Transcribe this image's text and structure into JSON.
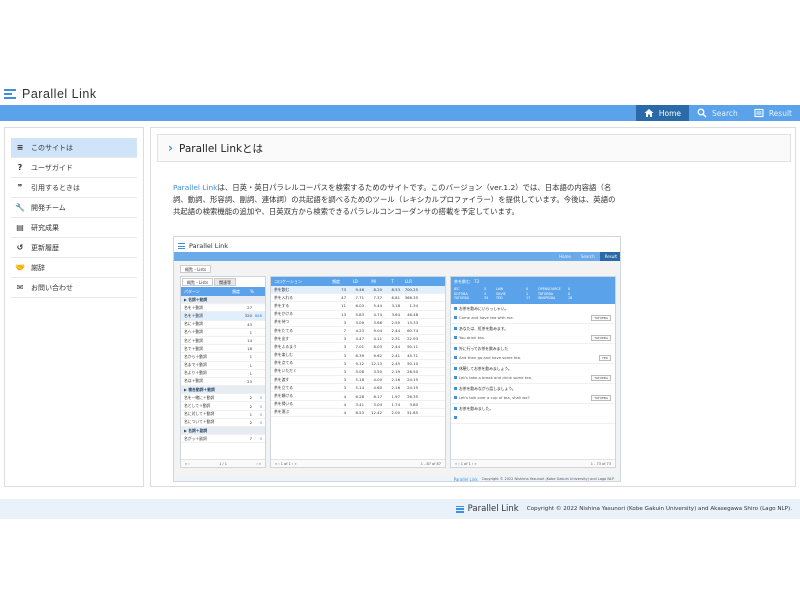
{
  "site": {
    "title": "Parallel Link"
  },
  "nav": {
    "items": [
      {
        "label": "Home",
        "icon": "home-icon"
      },
      {
        "label": "Search",
        "icon": "search-icon"
      },
      {
        "label": "Result",
        "icon": "result-icon"
      }
    ]
  },
  "sidebar": {
    "items": [
      {
        "label": "このサイトは",
        "icon": "list-icon",
        "glyph": "≡"
      },
      {
        "label": "ユーザガイド",
        "icon": "question-icon",
        "glyph": "?"
      },
      {
        "label": "引用するときは",
        "icon": "quote-icon",
        "glyph": "❞"
      },
      {
        "label": "開発チーム",
        "icon": "wrench-icon",
        "glyph": "🔧"
      },
      {
        "label": "研究成果",
        "icon": "document-icon",
        "glyph": "▤"
      },
      {
        "label": "更新履歴",
        "icon": "history-icon",
        "glyph": "↺"
      },
      {
        "label": "謝辞",
        "icon": "handshake-icon",
        "glyph": "🤝"
      },
      {
        "label": "お問い合わせ",
        "icon": "mail-icon",
        "glyph": "✉"
      }
    ]
  },
  "main": {
    "heading": "Parallel Linkとは",
    "intro_brand": "Parallel Link",
    "intro_text": "は、日英・英日パラレルコーパスを検索するためのサイトです。このバージョン（ver.1.2）では、日本語の内容語（名詞、動詞、形容詞、副詞、連体詞）の共起語を調べるためのツール（レキシカルプロファイラー）を提供しています。今後は、英語の共起語の検索機能の追加や、日英双方から検索できるパラレルコンコーダンサの搭載を予定しています。"
  },
  "preview": {
    "title": "Parallel Link",
    "nav": [
      "Home",
      "Search",
      "Result"
    ],
    "tabs": [
      "概覧・Lists",
      "関連等"
    ],
    "left_header": [
      "パターン",
      "頻度",
      "%"
    ],
    "left_rows": [
      {
        "t": "▶ 名詞＋動詞",
        "grp": true
      },
      {
        "t": "名を＋動詞",
        "n": "27",
        "p": ""
      },
      {
        "t": "名を＋動詞",
        "n": "320",
        "p": "888",
        "sel": true
      },
      {
        "t": "名に＋動詞",
        "n": "43",
        "p": ""
      },
      {
        "t": "名へ＋動詞",
        "n": "1",
        "p": ""
      },
      {
        "t": "名と＋動詞",
        "n": "14",
        "p": ""
      },
      {
        "t": "名で＋動詞",
        "n": "18",
        "p": ""
      },
      {
        "t": "名から＋動詞",
        "n": "1",
        "p": ""
      },
      {
        "t": "名まで＋動詞",
        "n": "1",
        "p": ""
      },
      {
        "t": "名より＋動詞",
        "n": "1",
        "p": ""
      },
      {
        "t": "名は＋動詞",
        "n": "23",
        "p": ""
      },
      {
        "t": "▶ 複合動詞＋動詞",
        "grp": true
      },
      {
        "t": "名を一緒に＋動詞",
        "n": "2",
        "p": "5"
      },
      {
        "t": "名として＋動詞",
        "n": "2",
        "p": "5"
      },
      {
        "t": "名に対して＋動詞",
        "n": "1",
        "p": "5"
      },
      {
        "t": "名について＋動詞",
        "n": "2",
        "p": "5"
      },
      {
        "t": "▶ 名詞＋副詞",
        "grp": true
      },
      {
        "t": "名がッ＋副詞",
        "n": "7",
        "p": "5"
      }
    ],
    "left_pager": "1 / 1",
    "mid_header": [
      "コロケーション",
      "頻度",
      "LD",
      "MI",
      "T",
      "LLR"
    ],
    "mid_rows": [
      [
        "茶を飲む",
        "73",
        "9.46",
        "8.20",
        "8.53",
        "700.25"
      ],
      [
        "茶を入れる",
        "47",
        "7.71",
        "7.37",
        "6.81",
        "366.35"
      ],
      [
        "茶をする",
        "11",
        "6.03",
        "5.44",
        "3.18",
        "1.34"
      ],
      [
        "茶をかける",
        "13",
        "5.83",
        "4.74",
        "3.64",
        "46.48"
      ],
      [
        "茶を持つ",
        "3",
        "3.09",
        "3.66",
        "2.55",
        "13.33"
      ],
      [
        "茶をたてる",
        "7",
        "4.23",
        "9.04",
        "2.44",
        "60.74"
      ],
      [
        "茶を出す",
        "3",
        "4.47",
        "4.11",
        "2.31",
        "22.93"
      ],
      [
        "茶をふるまう",
        "3",
        "7.01",
        "8.03",
        "2.44",
        "50.11"
      ],
      [
        "茶を楽しむ",
        "3",
        "6.39",
        "9.62",
        "2.41",
        "45.71"
      ],
      [
        "茶を点てる",
        "3",
        "9.12",
        "12.13",
        "2.45",
        "50.10"
      ],
      [
        "茶をいただく",
        "3",
        "5.08",
        "3.50",
        "2.19",
        "28.50"
      ],
      [
        "茶を渡す",
        "3",
        "5.18",
        "4.00",
        "2.16",
        "24.15"
      ],
      [
        "茶を立てる",
        "3",
        "5.14",
        "4.60",
        "2.16",
        "24.15"
      ],
      [
        "茶を頼ける",
        "4",
        "6.28",
        "6.17",
        "1.97",
        "26.35"
      ],
      [
        "茶を掃いる",
        "4",
        "3.41",
        "3.04",
        "1.74",
        "3.80"
      ],
      [
        "茶を運ぶ",
        "4",
        "6.53",
        "12.42",
        "2.00",
        "51.85"
      ]
    ],
    "mid_pager": "1 - 87 of 87",
    "right_header": "茶を飲む　73",
    "right_stats": [
      [
        "JEC",
        "5",
        "LAW",
        "0",
        "OPENSOURCE",
        "0"
      ],
      [
        "KOTOBA",
        "3",
        "SILVIE",
        "1",
        "TATOEBA",
        "0"
      ],
      [
        "TATOEBA",
        "35",
        "TED",
        "17",
        "WIKIPEDIA",
        "18"
      ]
    ],
    "examples": [
      {
        "j": "お茶を飲みにいらっしゃい。",
        "e": "Come and have tea with me.",
        "tag": "TATOEBA"
      },
      {
        "j": "あなたは、紅茶を飲みます。",
        "e": "You drink tea.",
        "tag": "TATOEBA"
      },
      {
        "j": "外に行ってお茶を飲みました",
        "e": "And then go and have some tea.",
        "tag": "TED"
      },
      {
        "j": "休憩してお茶を飲みましょう。",
        "e": "Let's take a break and drink some tea.",
        "tag": "TATOEBA"
      },
      {
        "j": "お茶を飲みながら話しましょう。",
        "e": "Let's talk over a cup of tea, shall we?",
        "tag": "TATOEBA"
      },
      {
        "j": "お茶を飲みました。",
        "e": "",
        "tag": ""
      }
    ],
    "right_pager": "1 - 73 of 73",
    "footer_brand": "Parallel Link",
    "footer_copy": "Copyright © 2022 Nishima Yasunori (Kobe Gakuin University) and Lago NLP"
  },
  "footer": {
    "brand": "Parallel Link",
    "copyright": "Copyright © 2022 Nishina Yasunori (Kobe Gakuin University) and Akasegawa Shiro (Lago NLP)."
  },
  "colors": {
    "accent": "#3f8fe0",
    "navbar": "#5aa3ea",
    "nav_active": "#2b6aa8",
    "footer_bg": "#e9f2fb",
    "side_active": "#cfe4f8"
  }
}
